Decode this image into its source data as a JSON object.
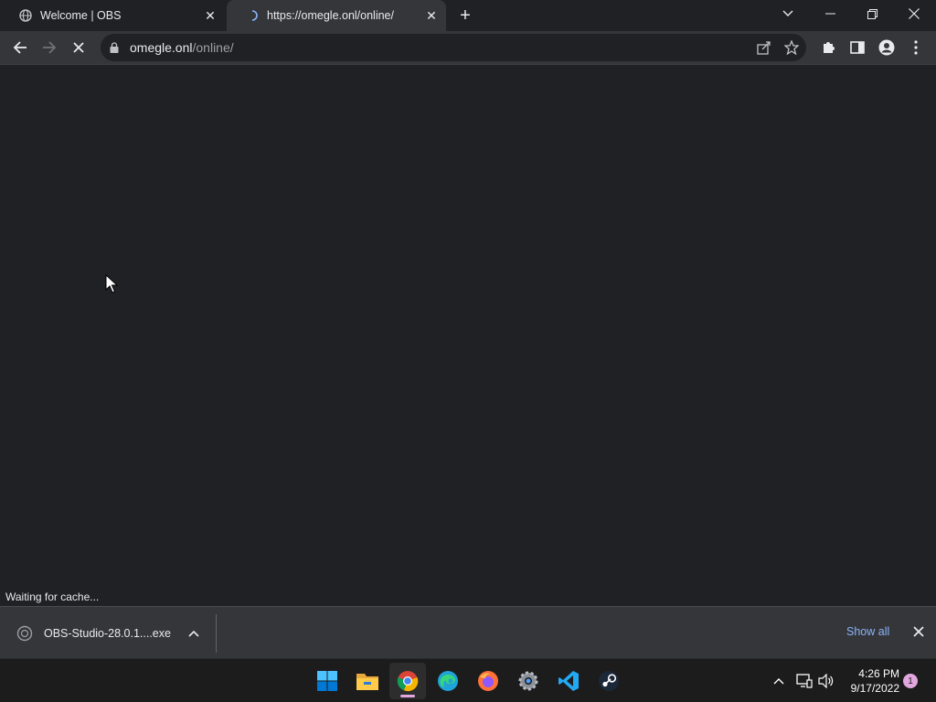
{
  "browser": {
    "tabs": [
      {
        "title": "Welcome | OBS",
        "icon": "globe-icon",
        "close": "✕"
      },
      {
        "title": "https://omegle.onl/online/",
        "icon": "loading-spinner-icon",
        "close": "✕"
      }
    ],
    "new_tab": "+",
    "address": {
      "host": "omegle.onl",
      "path": "/online/"
    },
    "status_text": "Waiting for cache..."
  },
  "downloads": {
    "item": {
      "name": "OBS-Studio-28.0.1....exe",
      "icon": "download-progress-icon"
    },
    "show_all": "Show all"
  },
  "taskbar": {
    "apps": [
      "windows-start-icon",
      "file-explorer-icon",
      "chrome-icon",
      "edge-icon",
      "firefox-icon",
      "settings-icon",
      "vscode-icon",
      "steam-icon"
    ],
    "clock": {
      "time": "4:26 PM",
      "date": "9/17/2022"
    },
    "notification_count": "1"
  },
  "colors": {
    "accent": "#8ab4f8",
    "indicator": "#e1a7de",
    "background": "#202124",
    "toolbar": "#35363a"
  }
}
